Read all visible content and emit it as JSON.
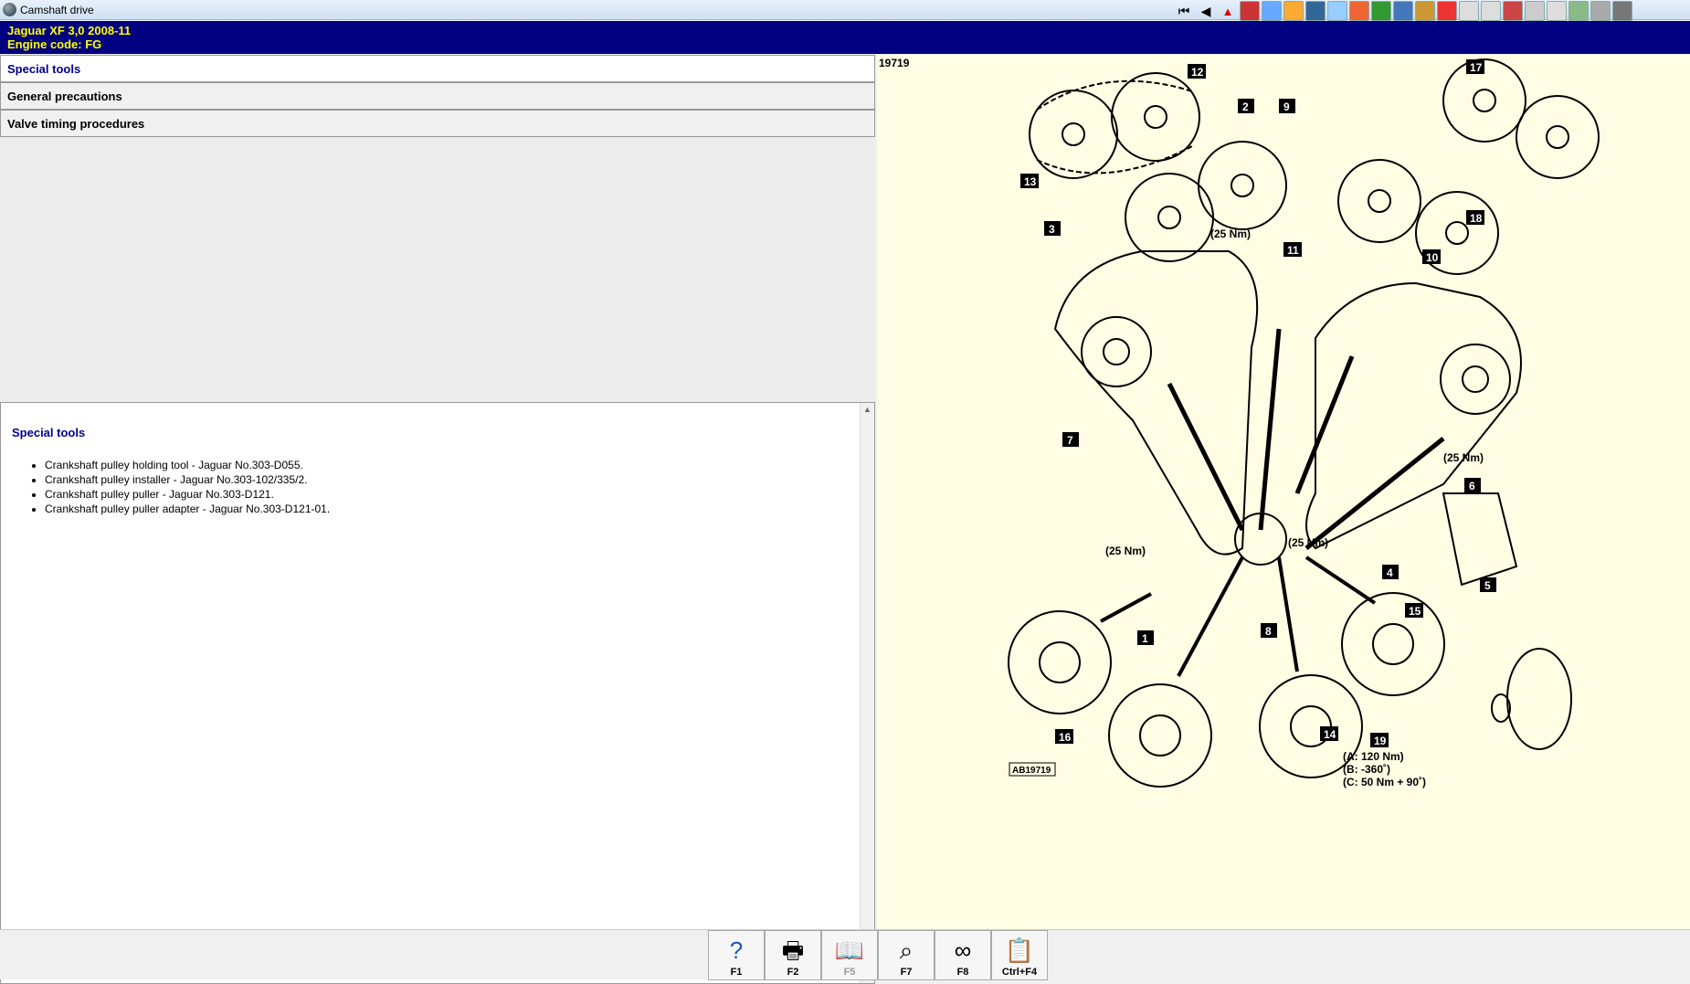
{
  "window": {
    "title": "Camshaft drive"
  },
  "header": {
    "line1": "Jaguar  XF  3,0  2008-11",
    "line2": "Engine code: FG"
  },
  "tabs": [
    {
      "label": "Special tools"
    },
    {
      "label": "General precautions"
    },
    {
      "label": "Valve timing procedures"
    }
  ],
  "content": {
    "heading": "Special tools",
    "items": [
      "Crankshaft pulley holding tool - Jaguar No.303-D055.",
      "Crankshaft pulley installer - Jaguar No.303-102/335/2.",
      "Crankshaft pulley puller - Jaguar No.303-D121.",
      "Crankshaft pulley puller adapter - Jaguar No.303-D121-01."
    ]
  },
  "diagram": {
    "ref": "19719",
    "code": "AB19719",
    "callouts": [
      "1",
      "2",
      "3",
      "4",
      "5",
      "6",
      "7",
      "8",
      "9",
      "10",
      "11",
      "12",
      "13",
      "14",
      "15",
      "16",
      "17",
      "18",
      "19"
    ],
    "torque": [
      "(25 Nm)",
      "(25 Nm)",
      "(25 Nm)",
      "(25 Nm)"
    ],
    "spec": [
      "(A: 120 Nm)",
      "(B: -360˚)",
      "(C: 50 Nm + 90˚)"
    ],
    "small_code": "AB19719"
  },
  "fkeys": [
    {
      "label": "F1",
      "icon": "help-icon",
      "disabled": false
    },
    {
      "label": "F2",
      "icon": "printer-icon",
      "disabled": false
    },
    {
      "label": "F5",
      "icon": "book-icon",
      "disabled": true
    },
    {
      "label": "F7",
      "icon": "zoom-icon",
      "disabled": false
    },
    {
      "label": "F8",
      "icon": "belt-icon",
      "disabled": false
    },
    {
      "label": "Ctrl+F4",
      "icon": "notes-icon",
      "disabled": false
    }
  ]
}
